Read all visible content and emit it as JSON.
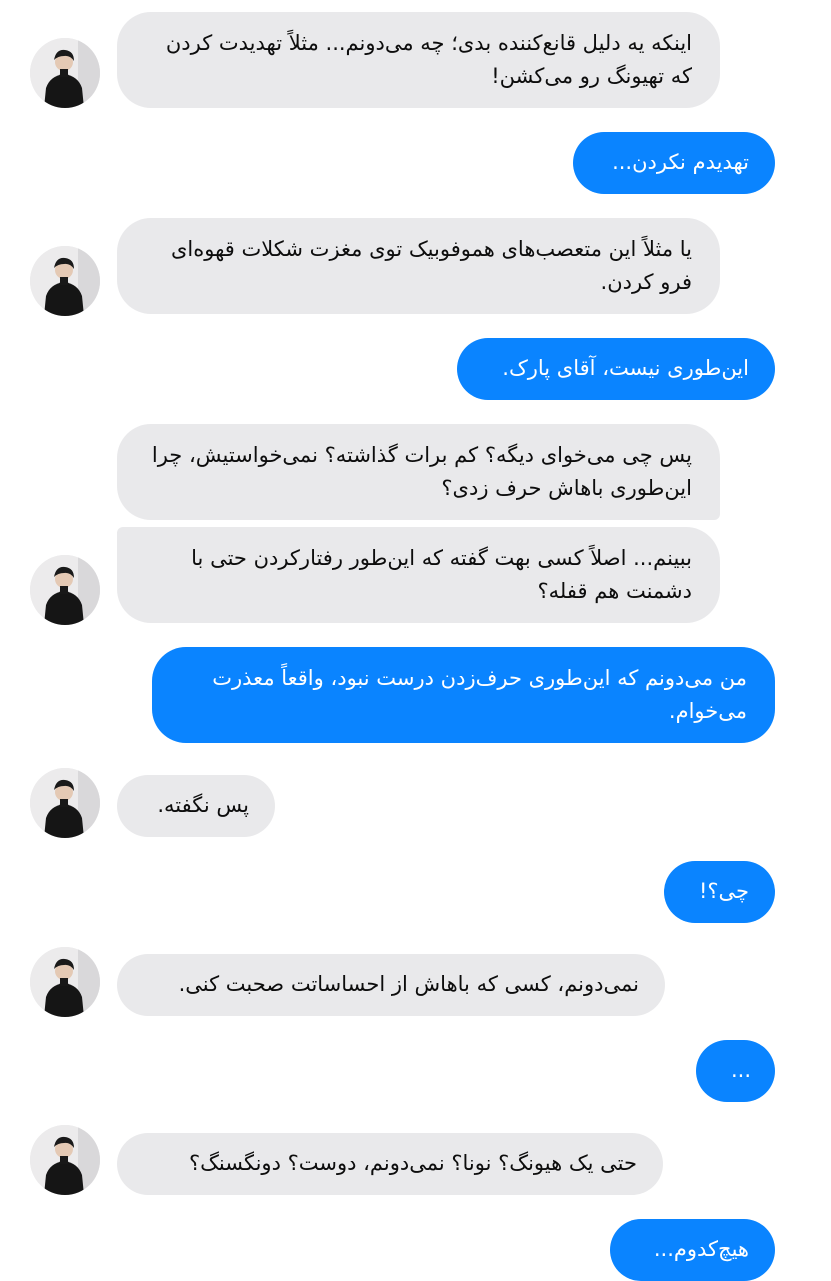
{
  "colors": {
    "incoming_bubble": "#e9e9eb",
    "outgoing_bubble": "#0a84ff",
    "incoming_text": "#0d0d0d",
    "outgoing_text": "#ffffff",
    "background": "#ffffff"
  },
  "avatar_icon": "profile-photo",
  "messages": [
    {
      "sender": "them",
      "text": "اینکه یه دلیل قانع‌کننده بدی؛ چه می‌دونم... مثلاً تهدیدت کردن که تهیونگ رو می‌کشن!"
    },
    {
      "sender": "me",
      "text": "تهدیدم نکردن..."
    },
    {
      "sender": "them",
      "text": "یا مثلاً این متعصب‌های هموفوبیک توی مغزت شکلات قهوه‌ای فرو کردن."
    },
    {
      "sender": "me",
      "text": "این‌طوری نیست، آقای پارک."
    },
    {
      "sender": "them",
      "text": "پس چی می‌خوای دیگه؟ کم برات گذاشته؟ نمی‌خواستیش، چرا این‌طوری باهاش حرف زدی؟"
    },
    {
      "sender": "them",
      "text": "ببینم... اصلاً کسی بهت گفته که این‌طور رفتارکردن حتی با دشمنت هم قفله؟"
    },
    {
      "sender": "me",
      "text": "من می‌دونم که این‌طوری حرف‌زدن درست نبود، واقعاً معذرت می‌خوام."
    },
    {
      "sender": "them",
      "text": "پس نگفته."
    },
    {
      "sender": "me",
      "text": "چی؟!"
    },
    {
      "sender": "them",
      "text": "نمی‌دونم، کسی که باهاش از احساساتت صحبت کنی."
    },
    {
      "sender": "me",
      "text": "..."
    },
    {
      "sender": "them",
      "text": "حتی یک هیونگ؟ نونا؟ نمی‌دونم، دوست؟ دونگسنگ؟"
    },
    {
      "sender": "me",
      "text": "هیچ‌کدوم..."
    }
  ]
}
